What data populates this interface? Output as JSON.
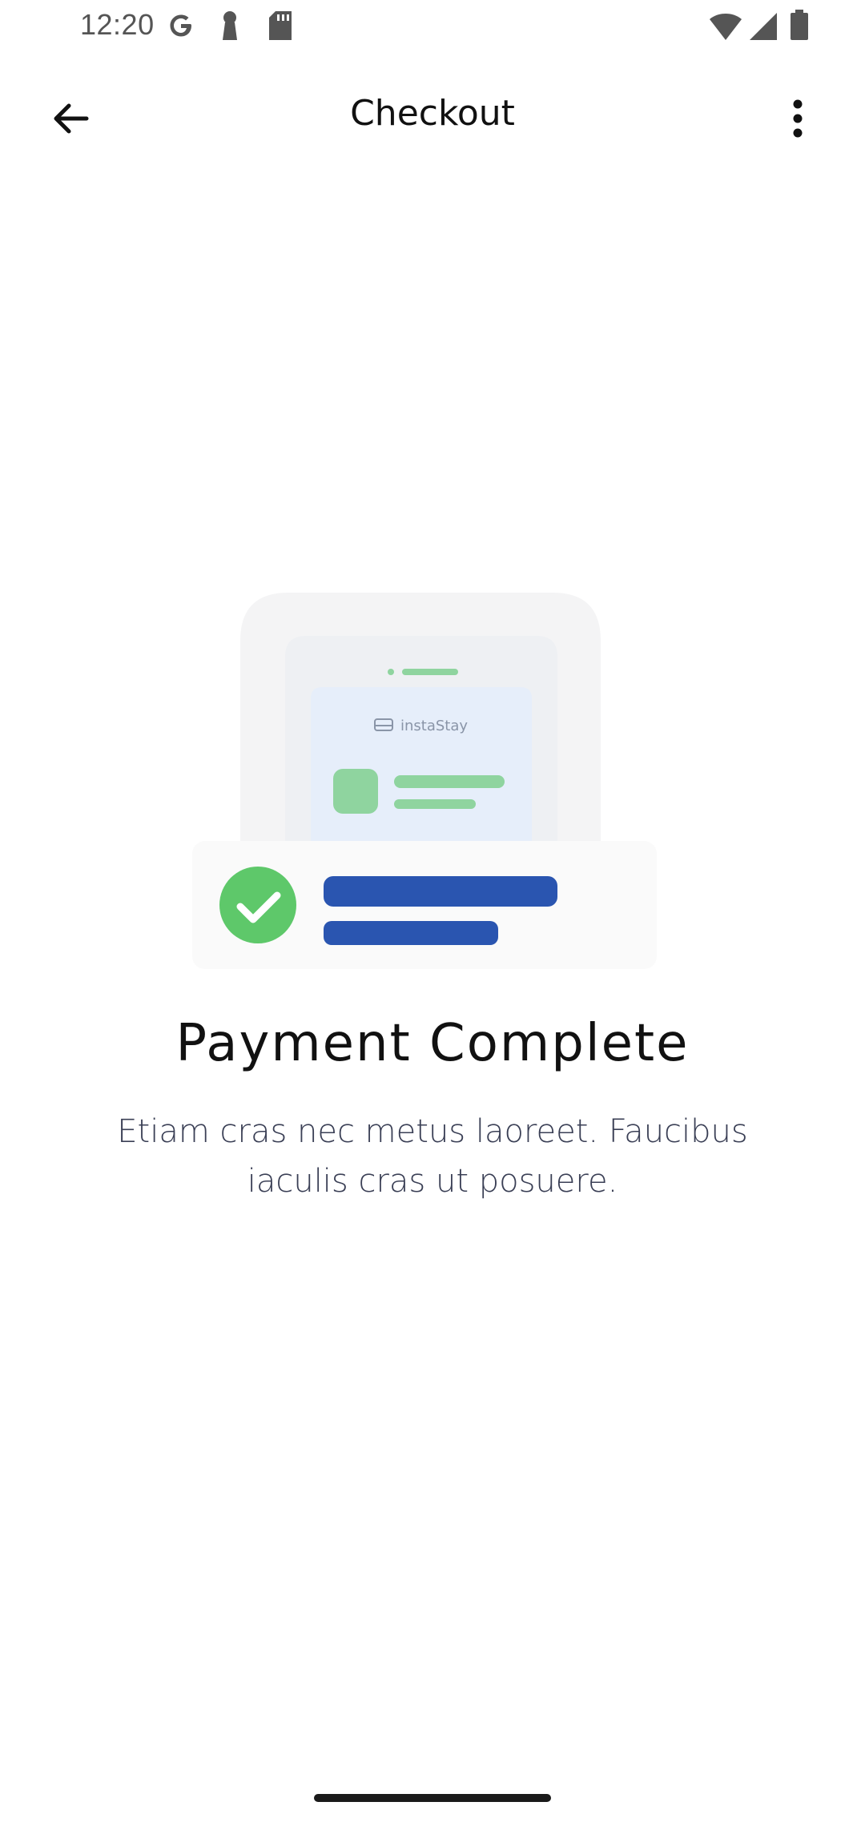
{
  "status_bar": {
    "time": "12:20",
    "icons": [
      "google-icon",
      "key-icon",
      "sd-card-icon",
      "wifi-icon",
      "signal-icon",
      "battery-icon"
    ]
  },
  "app_bar": {
    "title": "Checkout",
    "back_icon": "arrow-back-icon",
    "more_icon": "more-vert-icon"
  },
  "illustration": {
    "brand_label": "instaStay",
    "colors": {
      "outer_card": "#f4f4f5",
      "inner_card": "#eef0f3",
      "ticket": "#e6eefa",
      "green": "#5ec86a",
      "green_light": "#8fd49f",
      "blue_bar": "#2a55b0"
    }
  },
  "content": {
    "headline": "Payment Complete",
    "description": "Etiam cras nec metus laoreet. Faucibus iaculis cras ut posuere."
  }
}
